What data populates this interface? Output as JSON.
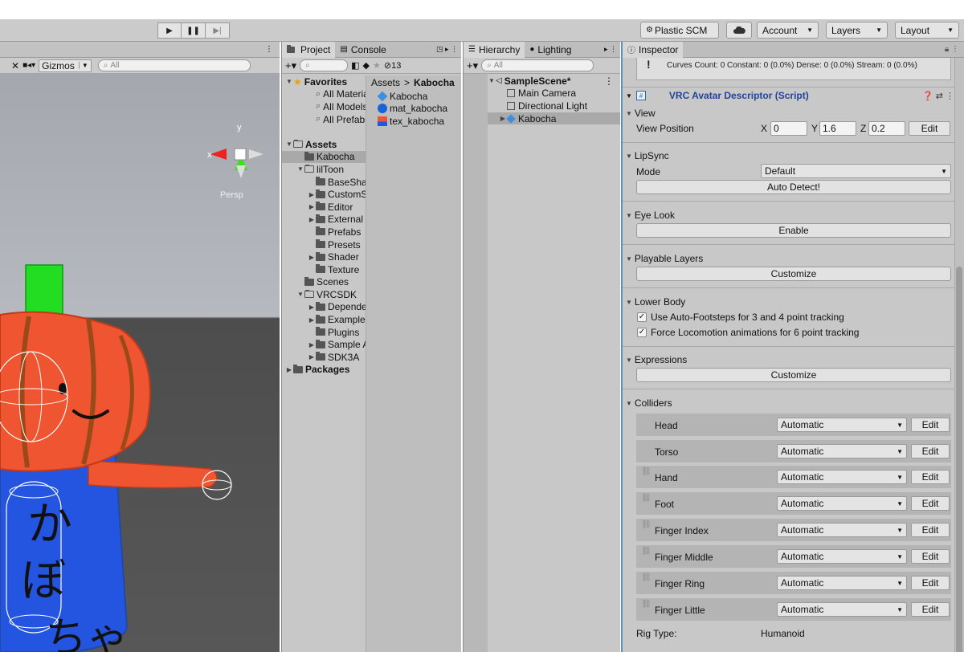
{
  "toolbar": {
    "play_icon": "play-icon",
    "pause_icon": "pause-icon",
    "step_icon": "step-icon",
    "plastic_scm": "Plastic SCM",
    "account": "Account",
    "layers": "Layers",
    "layout": "Layout"
  },
  "scene": {
    "gizmos": "Gizmos",
    "search_placeholder": "All",
    "view_label": "Persp",
    "axis_x": "x",
    "axis_y": "y",
    "character_text": [
      "か",
      "ぼ",
      "ちゃ"
    ]
  },
  "project": {
    "tabs": [
      "Project",
      "Console"
    ],
    "badge": "13",
    "search_placeholder": "",
    "tree": [
      {
        "label": "Favorites",
        "indent": 0,
        "arrow": "▼",
        "icon": "star",
        "bold": true
      },
      {
        "label": "All Materials",
        "indent": 2,
        "arrow": "",
        "icon": "search"
      },
      {
        "label": "All Models",
        "indent": 2,
        "arrow": "",
        "icon": "search"
      },
      {
        "label": "All Prefabs",
        "indent": 2,
        "arrow": "",
        "icon": "search"
      },
      {
        "label": "",
        "indent": 0,
        "arrow": "",
        "icon": "none"
      },
      {
        "label": "Assets",
        "indent": 0,
        "arrow": "▼",
        "icon": "open",
        "bold": true
      },
      {
        "label": "Kabocha",
        "indent": 1,
        "arrow": "",
        "icon": "folder",
        "selected": true
      },
      {
        "label": "lilToon",
        "indent": 1,
        "arrow": "▼",
        "icon": "open"
      },
      {
        "label": "BaseShader",
        "indent": 2,
        "arrow": "",
        "icon": "folder"
      },
      {
        "label": "CustomShaders",
        "indent": 2,
        "arrow": "▶",
        "icon": "folder"
      },
      {
        "label": "Editor",
        "indent": 2,
        "arrow": "▶",
        "icon": "folder"
      },
      {
        "label": "External",
        "indent": 2,
        "arrow": "▶",
        "icon": "folder"
      },
      {
        "label": "Prefabs",
        "indent": 2,
        "arrow": "",
        "icon": "folder"
      },
      {
        "label": "Presets",
        "indent": 2,
        "arrow": "",
        "icon": "folder"
      },
      {
        "label": "Shader",
        "indent": 2,
        "arrow": "▶",
        "icon": "folder"
      },
      {
        "label": "Texture",
        "indent": 2,
        "arrow": "",
        "icon": "folder"
      },
      {
        "label": "Scenes",
        "indent": 1,
        "arrow": "",
        "icon": "folder"
      },
      {
        "label": "VRCSDK",
        "indent": 1,
        "arrow": "▼",
        "icon": "open"
      },
      {
        "label": "Dependencies",
        "indent": 2,
        "arrow": "▶",
        "icon": "folder"
      },
      {
        "label": "Examples",
        "indent": 2,
        "arrow": "▶",
        "icon": "folder"
      },
      {
        "label": "Plugins",
        "indent": 2,
        "arrow": "",
        "icon": "folder"
      },
      {
        "label": "Sample Assets",
        "indent": 2,
        "arrow": "▶",
        "icon": "folder"
      },
      {
        "label": "SDK3A",
        "indent": 2,
        "arrow": "▶",
        "icon": "folder"
      },
      {
        "label": "Packages",
        "indent": 0,
        "arrow": "▶",
        "icon": "folder",
        "bold": true
      }
    ],
    "breadcrumb_root": "Assets",
    "breadcrumb_sep": ">",
    "breadcrumb_current": "Kabocha",
    "assets": [
      {
        "label": "Kabocha",
        "icon": "prefab"
      },
      {
        "label": "mat_kabocha",
        "icon": "material"
      },
      {
        "label": "tex_kabocha",
        "icon": "texture"
      }
    ]
  },
  "hierarchy": {
    "tabs": [
      "Hierarchy",
      "Lighting"
    ],
    "search_placeholder": "All",
    "scene_name": "SampleScene*",
    "items": [
      {
        "label": "Main Camera",
        "icon": "cube"
      },
      {
        "label": "Directional Light",
        "icon": "cube"
      },
      {
        "label": "Kabocha",
        "icon": "prefab"
      }
    ]
  },
  "inspector": {
    "tab": "Inspector",
    "info_line1": "Curves Count: 0 Constant: 0 (0.0%) Dense: 0 (0.0%) Stream: 0 (0.0%)",
    "component_title": "VRC Avatar Descriptor (Script)",
    "view": {
      "header": "View",
      "position_label": "View Position",
      "x_label": "X",
      "x": "0",
      "y_label": "Y",
      "y": "1.6",
      "z_label": "Z",
      "z": "0.2",
      "edit": "Edit"
    },
    "lipsync": {
      "header": "LipSync",
      "mode_label": "Mode",
      "mode_value": "Default",
      "button": "Auto Detect!"
    },
    "eyelook": {
      "header": "Eye Look",
      "button": "Enable"
    },
    "playable": {
      "header": "Playable Layers",
      "button": "Customize"
    },
    "lowerbody": {
      "header": "Lower Body",
      "opt1": "Use Auto-Footsteps for 3 and 4 point tracking",
      "opt2": "Force Locomotion animations for 6 point tracking"
    },
    "expressions": {
      "header": "Expressions",
      "button": "Customize"
    },
    "colliders": {
      "header": "Colliders",
      "edit": "Edit",
      "rows": [
        {
          "label": "Head",
          "value": "Automatic",
          "linked": false
        },
        {
          "label": "Torso",
          "value": "Automatic",
          "linked": false
        },
        {
          "label": "Hand",
          "value": "Automatic",
          "linked": true
        },
        {
          "label": "Foot",
          "value": "Automatic",
          "linked": true
        },
        {
          "label": "Finger Index",
          "value": "Automatic",
          "linked": true
        },
        {
          "label": "Finger Middle",
          "value": "Automatic",
          "linked": true
        },
        {
          "label": "Finger Ring",
          "value": "Automatic",
          "linked": true
        },
        {
          "label": "Finger Little",
          "value": "Automatic",
          "linked": true
        }
      ]
    },
    "rig_type_label": "Rig Type:",
    "rig_type_value": "Humanoid"
  }
}
